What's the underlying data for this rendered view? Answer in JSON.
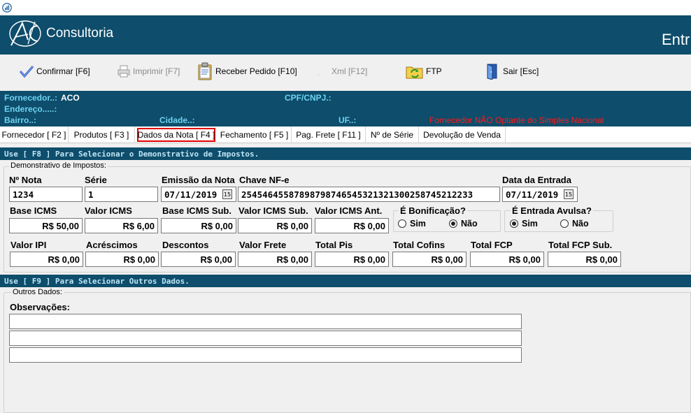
{
  "brand": {
    "name": "Consultoria",
    "screen_title": "Entr"
  },
  "toolbar": {
    "confirm": "Confirmar [F6]",
    "print": "Imprimir  [F7]",
    "receive": "Receber Pedido [F10]",
    "xml": "Xml [F12]",
    "ftp": "FTP",
    "exit": "Sair [Esc]"
  },
  "info": {
    "fornecedor_label": "Fornecedor..:",
    "fornecedor_value": "ACO",
    "cpf_label": "CPF/CNPJ.:",
    "endereco_label": "Endereço.....:",
    "bairro_label": "Bairro..:",
    "cidade_label": "Cidade..:",
    "uf_label": "UF..:",
    "warning": "Fornecedor NÃO Optante do Simples Nacional"
  },
  "tabs": [
    {
      "label": "Fornecedor [ F2 ]"
    },
    {
      "label": "Produtos [ F3 ]"
    },
    {
      "label": "Dados da Nota [ F4 ]"
    },
    {
      "label": "Fechamento [ F5 ]"
    },
    {
      "label": "Pag. Frete [ F11 ]"
    },
    {
      "label": "Nº de Série"
    },
    {
      "label": "Devolução de Venda"
    }
  ],
  "impostos": {
    "header": "Use [ F8 ] Para Selecionar o Demonstrativo de Impostos.",
    "group_label": "Demonstrativo de Impostos:",
    "nota_label": "Nº Nota",
    "nota_value": "1234",
    "serie_label": "Série",
    "serie_value": "1",
    "emissao_label": "Emissão da Nota",
    "emissao_value": "07/11/2019",
    "chave_label": "Chave NF-e",
    "chave_value": "25454645587898798746545321321300258745212233",
    "entrada_label": "Data da Entrada",
    "entrada_value": "07/11/2019",
    "base_icms_label": "Base ICMS",
    "base_icms_value": "R$ 50,00",
    "valor_icms_label": "Valor ICMS",
    "valor_icms_value": "R$ 6,00",
    "base_icms_sub_label": "Base ICMS Sub.",
    "base_icms_sub_value": "R$ 0,00",
    "valor_icms_sub_label": "Valor ICMS Sub.",
    "valor_icms_sub_value": "R$ 0,00",
    "valor_icms_ant_label": "Valor ICMS Ant.",
    "valor_icms_ant_value": "R$ 0,00",
    "bonificacao_label": "É Bonificação?",
    "avulsa_label": "É Entrada Avulsa?",
    "sim": "Sim",
    "nao": "Não",
    "bonificacao_selected": "Não",
    "avulsa_selected": "Sim",
    "ipi_label": "Valor IPI",
    "ipi_value": "R$ 0,00",
    "acrescimos_label": "Acréscimos",
    "acrescimos_value": "R$ 0,00",
    "descontos_label": "Descontos",
    "descontos_value": "R$ 0,00",
    "frete_label": "Valor Frete",
    "frete_value": "R$ 0,00",
    "pis_label": "Total Pis",
    "pis_value": "R$ 0,00",
    "cofins_label": "Total Cofins",
    "cofins_value": "R$ 0,00",
    "fcp_label": "Total FCP",
    "fcp_value": "R$ 0,00",
    "fcp_sub_label": "Total FCP Sub.",
    "fcp_sub_value": "R$ 0,00"
  },
  "outros": {
    "header": "Use [ F9 ] Para Selecionar Outros Dados.",
    "group_label": "Outros Dados:",
    "obs_label": "Observações:",
    "obs_lines": [
      "",
      "",
      ""
    ]
  },
  "colors": {
    "banner": "#0e4d6b",
    "info_label": "#6cd3f2",
    "warning": "#ff1a1a",
    "active_tab_border": "#e00000"
  }
}
